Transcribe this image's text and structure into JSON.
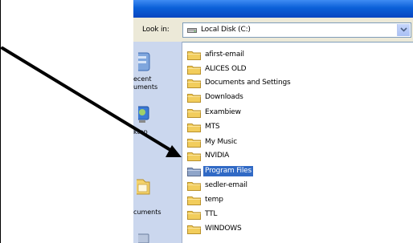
{
  "look_in": {
    "label": "Look in:",
    "value": "Local Disk (C:)"
  },
  "places": [
    {
      "label": "",
      "icon": "recent-documents-icon"
    },
    {
      "label": "ecent\numents",
      "icon": "recent-documents-icon"
    },
    {
      "label": "ktop",
      "icon": "desktop-icon"
    },
    {
      "label": "cuments",
      "icon": "my-documents-icon"
    }
  ],
  "files": [
    {
      "name": "afirst-email",
      "selected": false
    },
    {
      "name": "ALICES OLD",
      "selected": false
    },
    {
      "name": "Documents and Settings",
      "selected": false
    },
    {
      "name": "Downloads",
      "selected": false
    },
    {
      "name": "Exambiew",
      "selected": false
    },
    {
      "name": "MTS",
      "selected": false
    },
    {
      "name": "My Music",
      "selected": false
    },
    {
      "name": "NVIDIA",
      "selected": false
    },
    {
      "name": "Program Files",
      "selected": true
    },
    {
      "name": "sedler-email",
      "selected": false
    },
    {
      "name": "temp",
      "selected": false
    },
    {
      "name": "TTL",
      "selected": false
    },
    {
      "name": "WINDOWS",
      "selected": false
    }
  ],
  "colors": {
    "selection": "#316ac5",
    "places_bar": "#cbd7ee",
    "dialog_bg": "#ece9d8",
    "folder": "#f2cd5c",
    "arrow": "#000000"
  }
}
